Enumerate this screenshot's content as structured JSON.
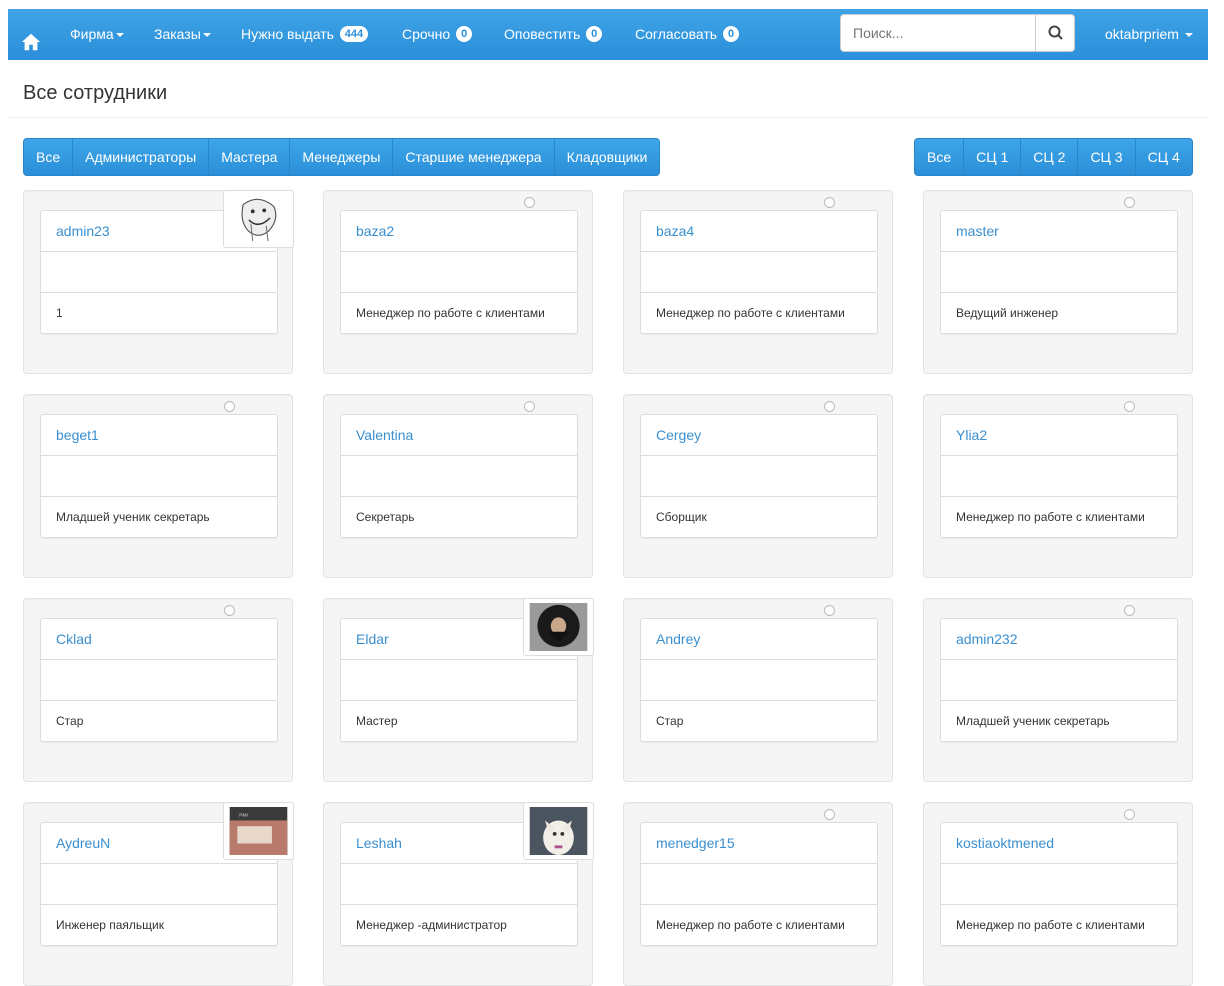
{
  "nav": {
    "firm": "Фирма",
    "orders": "Заказы",
    "issue": "Нужно выдать",
    "issue_count": "444",
    "urgent": "Срочно",
    "urgent_count": "0",
    "notify": "Оповестить",
    "notify_count": "0",
    "approve": "Согласовать",
    "approve_count": "0",
    "search_placeholder": "Поиск...",
    "user": "oktabrpriem"
  },
  "page_title": "Все сотрудники",
  "role_filters": [
    "Все",
    "Администраторы",
    "Мастера",
    "Менеджеры",
    "Старшие менеджера",
    "Кладовщики"
  ],
  "sc_filters": [
    "Все",
    "СЦ 1",
    "СЦ 2",
    "СЦ 3",
    "СЦ 4"
  ],
  "employees": [
    {
      "name": "admin23",
      "role": "1",
      "photo": "troll-face"
    },
    {
      "name": "baza2",
      "role": "Менеджер по работе с клиентами"
    },
    {
      "name": "baza4",
      "role": "Менеджер по работе с клиентами"
    },
    {
      "name": "master",
      "role": "Ведущий инженер"
    },
    {
      "name": "beget1",
      "role": "Младшей ученик секретарь"
    },
    {
      "name": "Valentina",
      "role": "Секретарь"
    },
    {
      "name": "Cergey",
      "role": "Сборщик"
    },
    {
      "name": "Ylia2",
      "role": "Менеджер по работе с клиентами"
    },
    {
      "name": "Cklad",
      "role": "Стар"
    },
    {
      "name": "Eldar",
      "role": "Мастер",
      "photo": "bearded-man"
    },
    {
      "name": "Andrey",
      "role": "Стар"
    },
    {
      "name": "admin232",
      "role": "Младшей ученик секретарь"
    },
    {
      "name": "AydreuN",
      "role": "Инженер паяльщик",
      "photo": "person-photo"
    },
    {
      "name": "Leshah",
      "role": "Менеджер -администратор",
      "photo": "cat"
    },
    {
      "name": "menedger15",
      "role": "Менеджер по работе с клиентами"
    },
    {
      "name": "kostiaoktmened",
      "role": "Менеджер по работе с клиентами"
    }
  ],
  "colors": {
    "accent": "#2b8fda",
    "link": "#3a8fd0"
  }
}
